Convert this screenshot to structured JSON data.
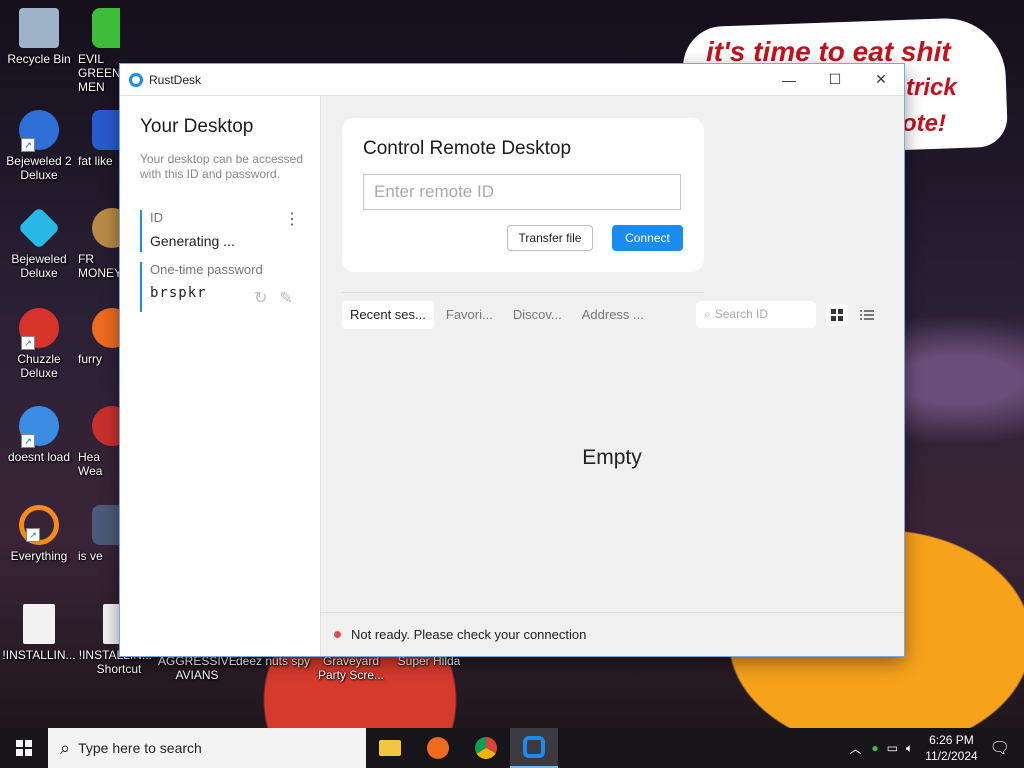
{
  "desktop": {
    "sticker_lines": [
      "it's time to eat shit",
      "trick",
      "ote!"
    ],
    "icons": [
      {
        "label": "Recycle Bin",
        "color": "#9fb3c8"
      },
      {
        "label": "Bejeweled 2 Deluxe",
        "color": "#2f6fd8"
      },
      {
        "label": "Bejeweled Deluxe",
        "color": "#27b8e8"
      },
      {
        "label": "Chuzzle Deluxe",
        "color": "#d8342b"
      },
      {
        "label": "doesnt load",
        "color": "#3b8de3"
      },
      {
        "label": "Everything",
        "color": "#f58b1f"
      },
      {
        "label": "!INSTALLIN...",
        "color": "#f2f2f2"
      }
    ],
    "partial_icons": [
      {
        "label": "EVIL GREEN MEN",
        "color": "#3dbd3a"
      },
      {
        "label": "fat like",
        "color": "#2a5ad0"
      },
      {
        "label": "FR MONEY",
        "color": "#b88a45"
      },
      {
        "label": "furry",
        "color": "#ef6b1e"
      },
      {
        "label": "Hea Wea",
        "color": "#c9302c"
      },
      {
        "label": "is ve",
        "color": "#4b5a7a"
      },
      {
        "label": "!INSTALLIN... - Shortcut",
        "color": "#f2f2f2"
      }
    ],
    "bottom_labels": [
      "AGGRESSIVE AVIANS",
      "deez nuts spy",
      "Graveyard Party Scre...",
      "Super Hilda"
    ]
  },
  "window": {
    "title": "RustDesk",
    "controls": {
      "minimize": "—",
      "maximize": "☐",
      "close": "✕"
    }
  },
  "sidebar": {
    "heading": "Your Desktop",
    "description": "Your desktop can be accessed with this ID and password.",
    "id_label": "ID",
    "id_value": "Generating ...",
    "password_label": "One-time password",
    "password_value": "brspkr"
  },
  "connect_card": {
    "heading": "Control Remote Desktop",
    "input_placeholder": "Enter remote ID",
    "transfer_button": "Transfer file",
    "connect_button": "Connect"
  },
  "tabs": [
    {
      "label": "Recent ses...",
      "active": true
    },
    {
      "label": "Favori...",
      "active": false
    },
    {
      "label": "Discov...",
      "active": false
    },
    {
      "label": "Address ...",
      "active": false
    }
  ],
  "search_placeholder": "Search ID",
  "empty_text": "Empty",
  "status_text": "Not ready. Please check your connection",
  "taskbar": {
    "search_placeholder": "Type here to search",
    "time": "6:26 PM",
    "date": "11/2/2024"
  },
  "colors": {
    "accent": "#1a8cf0",
    "status_dot": "#e44c4c"
  }
}
